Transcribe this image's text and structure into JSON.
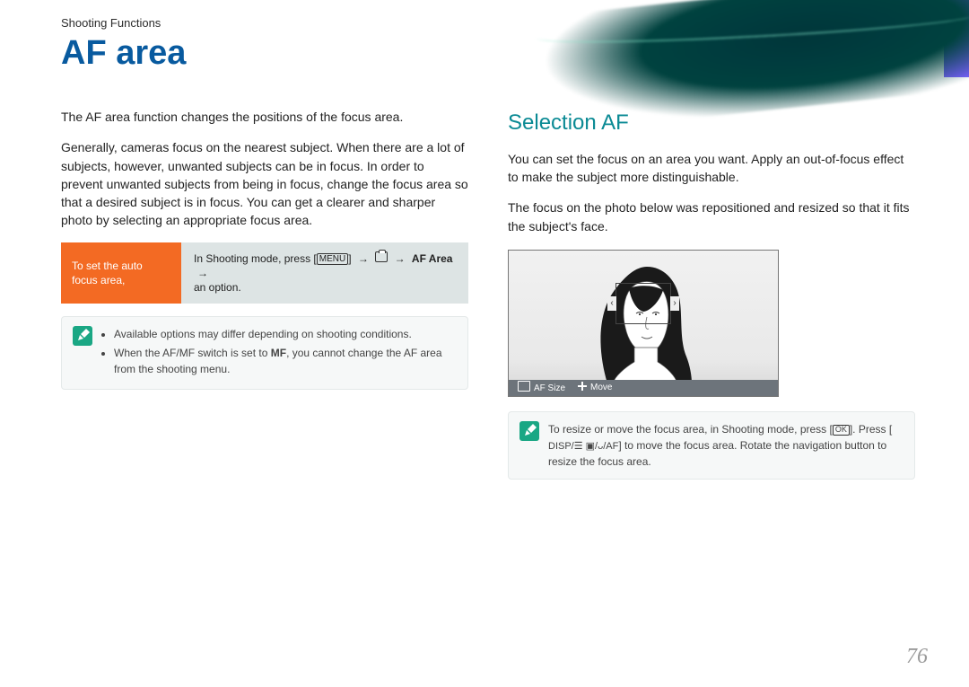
{
  "header": {
    "crumb": "Shooting Functions",
    "title": "AF area"
  },
  "left": {
    "p1": "The AF area function changes the positions of the focus area.",
    "p2": "Generally, cameras focus on the nearest subject. When there are a lot of subjects, however, unwanted subjects can be in focus. In order to prevent unwanted subjects from being in focus, change the focus area so that a desired subject is in focus. You can get a clearer and sharper photo by selecting an appropriate focus area.",
    "instr_label": "To set the auto focus area,",
    "instr_pre": "In Shooting mode, press [",
    "instr_menu": "MENU",
    "instr_mid1": "] ",
    "instr_arrow": "→",
    "instr_afarea": "AF Area",
    "instr_end": "an option.",
    "note1": "Available options may differ depending on shooting conditions.",
    "note2_a": "When the AF/MF switch is set to ",
    "note2_b": "MF",
    "note2_c": ", you cannot change the AF area from the shooting menu."
  },
  "right": {
    "subhead": "Selection AF",
    "p1": "You can set the focus on an area you want. Apply an out-of-focus effect to make the subject more distinguishable.",
    "p2": "The focus on the photo below was repositioned and resized so that it fits the subject's face.",
    "bar_afsize": "AF Size",
    "bar_move": "Move",
    "tip_a": "To resize or move the focus area, in Shooting mode, press [",
    "tip_ok": "OK",
    "tip_b": "]. Press [",
    "tip_disp": "DISP/☰ ▣/ᴗ/AF",
    "tip_c": "] to move the focus area. Rotate the navigation button to resize the focus area."
  },
  "page_number": "76"
}
